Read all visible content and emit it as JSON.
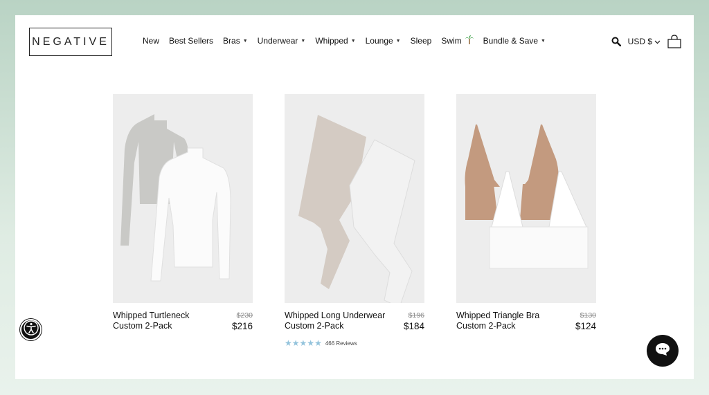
{
  "header": {
    "logo": "NEGATIVE",
    "nav": [
      {
        "label": "New",
        "dropdown": false
      },
      {
        "label": "Best Sellers",
        "dropdown": false
      },
      {
        "label": "Bras",
        "dropdown": true
      },
      {
        "label": "Underwear",
        "dropdown": true
      },
      {
        "label": "Whipped",
        "dropdown": true
      },
      {
        "label": "Lounge",
        "dropdown": true
      },
      {
        "label": "Sleep",
        "dropdown": false
      },
      {
        "label": "Swim",
        "dropdown": false,
        "icon": "palm-tree-icon"
      },
      {
        "label": "Bundle & Save",
        "dropdown": true
      }
    ],
    "currency": "USD $",
    "icons": [
      "search-icon",
      "chevron-down-icon",
      "shopping-bag-icon"
    ]
  },
  "products": [
    {
      "name_line1": "Whipped Turtleneck",
      "name_line2": "Custom 2-Pack",
      "old_price": "$230",
      "price": "$216"
    },
    {
      "name_line1": "Whipped Long Underwear",
      "name_line2": "Custom 2-Pack",
      "old_price": "$196",
      "price": "$184",
      "rating_stars": 5,
      "reviews": "466 Reviews"
    },
    {
      "name_line1": "Whipped Triangle Bra",
      "name_line2": "Custom 2-Pack",
      "old_price": "$130",
      "price": "$124"
    }
  ],
  "colors": {
    "page_bg": "#b9d3c4",
    "card_bg": "#ededed",
    "star": "#93c3dc",
    "button": "#111111"
  },
  "widgets": {
    "accessibility_icon": "accessibility-icon",
    "chat_icon": "chat-icon"
  }
}
